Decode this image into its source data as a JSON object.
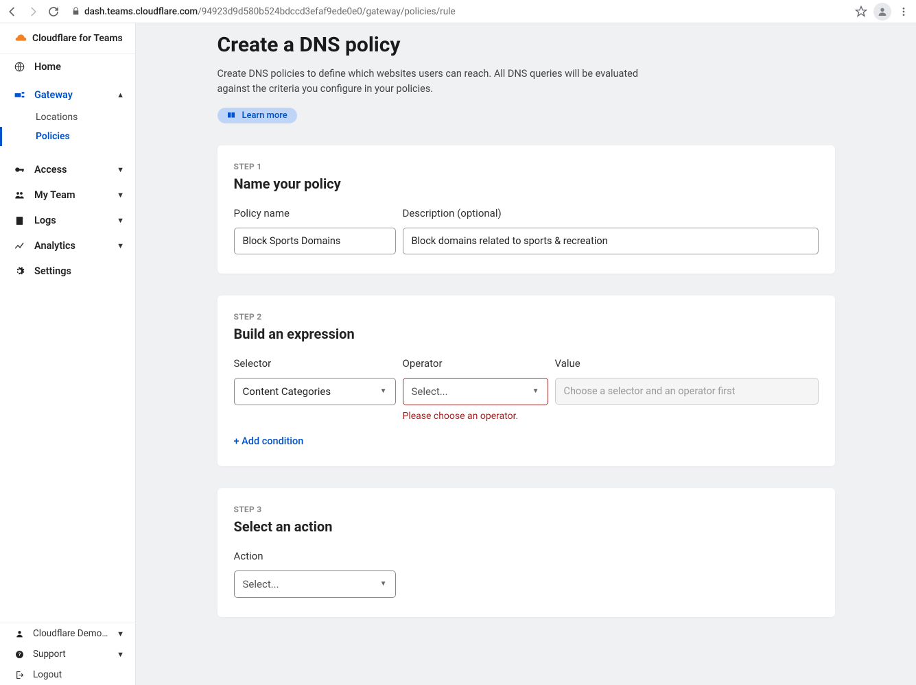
{
  "browser": {
    "url_host": "dash.teams.cloudflare.com",
    "url_path": "/94923d9d580b524bdccd3efaf9ede0e0/gateway/policies/rule"
  },
  "brand": "Cloudflare for Teams",
  "nav": {
    "home": "Home",
    "gateway": "Gateway",
    "gateway_sub": {
      "locations": "Locations",
      "policies": "Policies"
    },
    "access": "Access",
    "myteam": "My Team",
    "logs": "Logs",
    "analytics": "Analytics",
    "settings": "Settings"
  },
  "sidebar_bottom": {
    "account": "Cloudflare Demo d...",
    "support": "Support",
    "logout": "Logout"
  },
  "page": {
    "title": "Create a DNS policy",
    "desc": "Create DNS policies to define which websites users can reach. All DNS queries will be evaluated against the criteria you configure in your policies.",
    "learn_more": "Learn more"
  },
  "step1": {
    "label": "STEP 1",
    "title": "Name your policy",
    "name_label": "Policy name",
    "name_value": "Block Sports Domains",
    "desc_label": "Description (optional)",
    "desc_value": "Block domains related to sports & recreation"
  },
  "step2": {
    "label": "STEP 2",
    "title": "Build an expression",
    "selector_label": "Selector",
    "selector_value": "Content Categories",
    "operator_label": "Operator",
    "operator_placeholder": "Select...",
    "operator_error": "Please choose an operator.",
    "value_label": "Value",
    "value_placeholder": "Choose a selector and an operator first",
    "add_condition": "+ Add condition"
  },
  "step3": {
    "label": "STEP 3",
    "title": "Select an action",
    "action_label": "Action",
    "action_placeholder": "Select..."
  }
}
